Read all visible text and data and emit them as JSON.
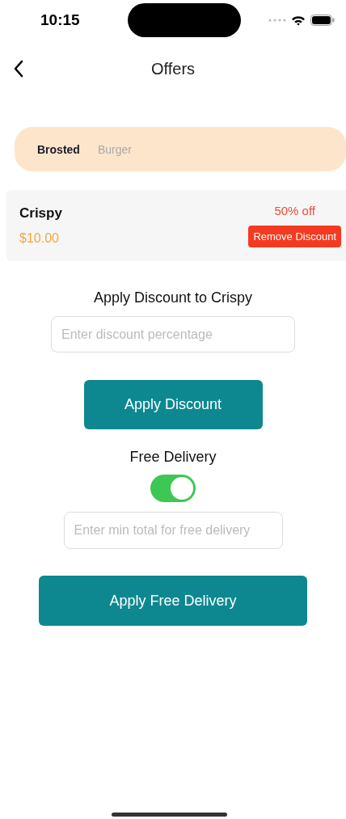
{
  "status_bar": {
    "time": "10:15"
  },
  "nav": {
    "title": "Offers"
  },
  "categories": [
    {
      "label": "Brosted",
      "selected": true
    },
    {
      "label": "Burger",
      "selected": false
    }
  ],
  "items": [
    {
      "name": "Crispy",
      "price": "$10.00",
      "discount": "50% off",
      "action": "Remove Discount"
    }
  ],
  "discount": {
    "heading": "Apply Discount to Crispy",
    "placeholder": "Enter discount percentage",
    "button": "Apply Discount"
  },
  "free_delivery": {
    "label": "Free Delivery",
    "on": true,
    "placeholder": "Enter min total for free delivery",
    "button": "Apply Free Delivery"
  }
}
